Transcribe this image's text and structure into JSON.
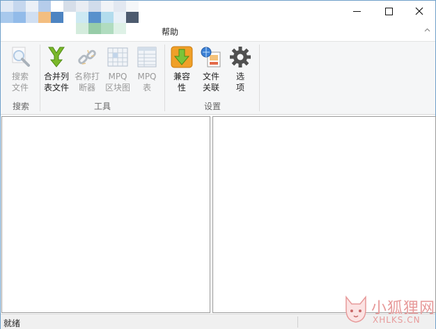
{
  "window": {
    "menu_tab": "帮助",
    "collapse_glyph": "^"
  },
  "ribbon": {
    "groups": [
      {
        "label": "搜索",
        "buttons": [
          {
            "label": "搜索\n文件",
            "icon": "magnifier-icon",
            "enabled": false
          }
        ]
      },
      {
        "label": "工具",
        "buttons": [
          {
            "label": "合并列\n表文件",
            "icon": "merge-arrow-icon",
            "enabled": true
          },
          {
            "label": "名称打\n断器",
            "icon": "broken-chain-icon",
            "enabled": false
          },
          {
            "label": "MPQ\n区块图",
            "icon": "block-grid-icon",
            "enabled": false
          },
          {
            "label": "MPQ\n表",
            "icon": "table-icon",
            "enabled": false
          }
        ]
      },
      {
        "label": "设置",
        "buttons": [
          {
            "label": "兼容\n性",
            "icon": "download-compat-icon",
            "enabled": true
          },
          {
            "label": "文件\n关联",
            "icon": "file-association-icon",
            "enabled": true
          },
          {
            "label": "选\n项",
            "icon": "gear-icon",
            "enabled": true
          }
        ]
      }
    ]
  },
  "statusbar": {
    "text": "就绪"
  },
  "watermark": {
    "brand_cn": "小狐狸网",
    "brand_en": "XHLKS.CN"
  },
  "colors": {
    "accent_orange": "#f0a028",
    "merge_green": "#7ab82a",
    "watermark": "#e79a9a"
  }
}
